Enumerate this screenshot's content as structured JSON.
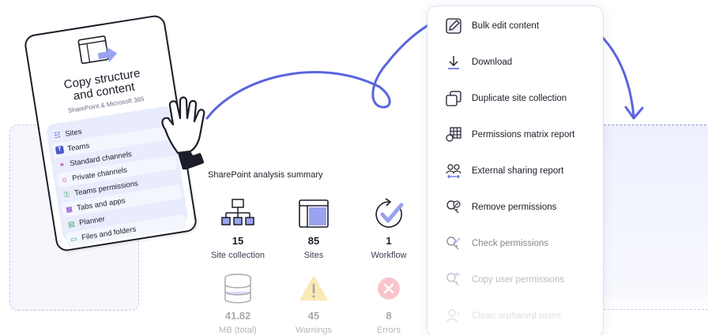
{
  "card": {
    "title_line1": "Copy structure",
    "title_line2": "and content",
    "subtitle": "SharePoint & Microsoft 365",
    "items": [
      {
        "label": "Sites",
        "icon": "sitemap-icon",
        "color": "#4a5be0"
      },
      {
        "label": "Teams",
        "icon": "teams-icon",
        "color": "#5059c9"
      },
      {
        "label": "Standard channels",
        "icon": "people-icon",
        "color": "#d13aa0"
      },
      {
        "label": "Private channels",
        "icon": "person-icon",
        "color": "#d13a7a"
      },
      {
        "label": "Teams permissions",
        "icon": "key-icon",
        "color": "#2e9e4a"
      },
      {
        "label": "Tabs and apps",
        "icon": "apps-icon",
        "color": "#8a3ad1"
      },
      {
        "label": "Planner",
        "icon": "planner-icon",
        "color": "#3aa86b"
      },
      {
        "label": "Files and folders",
        "icon": "files-icon",
        "color": "#2e9e6a"
      }
    ]
  },
  "summary": {
    "title": "SharePoint analysis summary",
    "stats": [
      {
        "value": "15",
        "label": "Site collection",
        "icon": "sitemap-icon"
      },
      {
        "value": "85",
        "label": "Sites",
        "icon": "window-icon"
      },
      {
        "value": "1",
        "label": "Workflow",
        "icon": "refresh-check-icon"
      },
      {
        "value": "41.82",
        "label": "MB (total)",
        "icon": "database-icon"
      },
      {
        "value": "45",
        "label": "Warnings",
        "icon": "warning-icon"
      },
      {
        "value": "8",
        "label": "Errors",
        "icon": "error-icon"
      }
    ]
  },
  "menu": {
    "items": [
      {
        "label": "Bulk edit content",
        "icon": "edit-icon"
      },
      {
        "label": "Download",
        "icon": "download-icon"
      },
      {
        "label": "Duplicate site collection",
        "icon": "duplicate-icon"
      },
      {
        "label": "Permissions matrix report",
        "icon": "matrix-icon"
      },
      {
        "label": "External sharing report",
        "icon": "sharing-icon"
      },
      {
        "label": "Remove permissions",
        "icon": "key-remove-icon"
      },
      {
        "label": "Check permissions",
        "icon": "key-check-icon"
      },
      {
        "label": "Copy user permissions",
        "icon": "key-copy-icon"
      },
      {
        "label": "Clean orphaned users",
        "icon": "user-clean-icon"
      }
    ]
  },
  "colors": {
    "accent": "#5a64e0",
    "accent_light": "#9aa3f0",
    "warning": "#f5c842",
    "error": "#f06a7a"
  }
}
